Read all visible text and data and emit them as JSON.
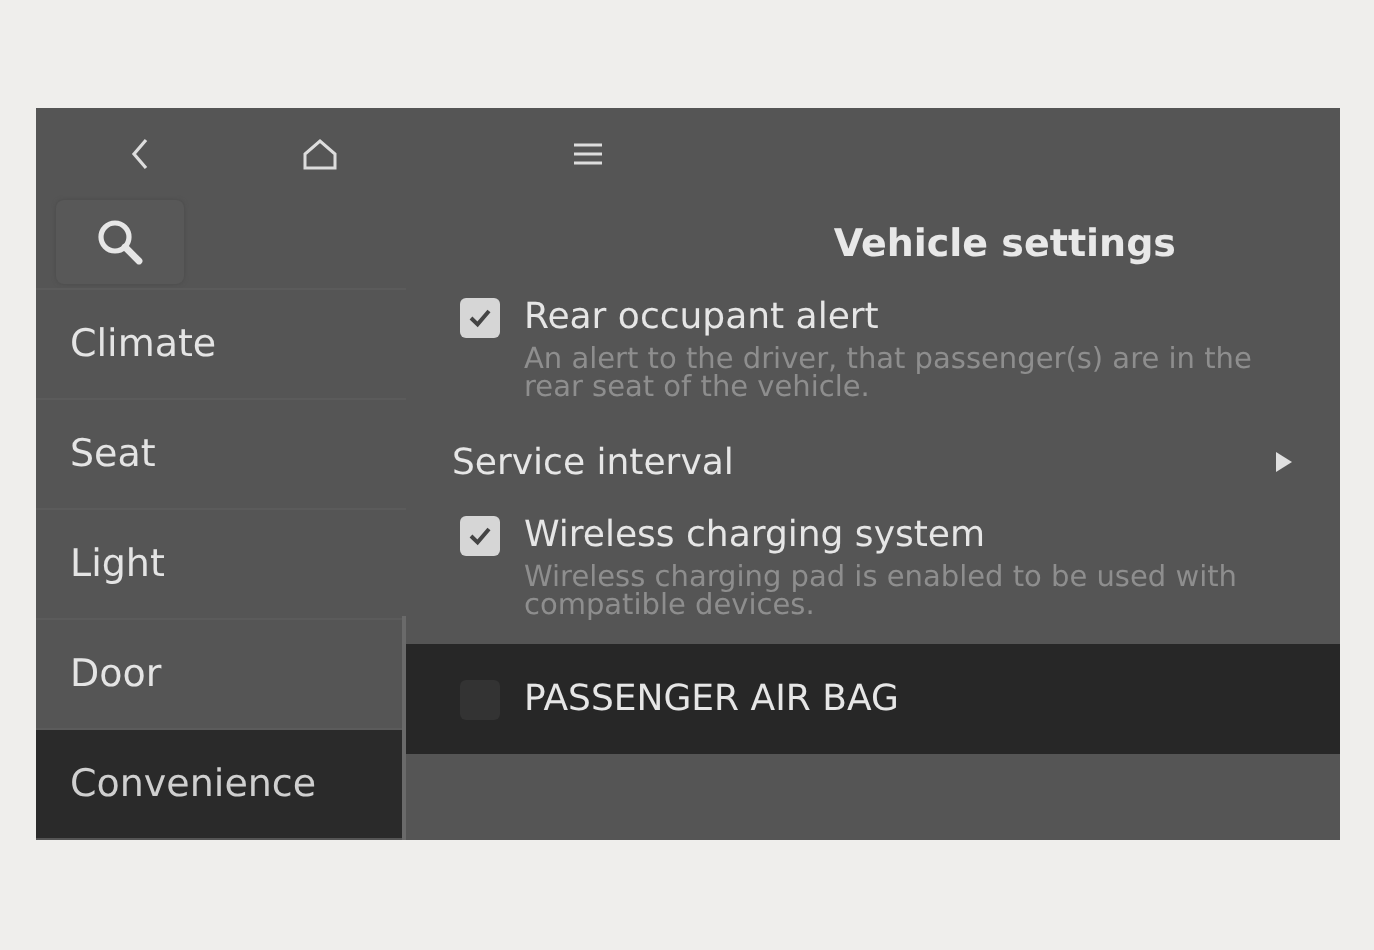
{
  "top_bar": {
    "buttons": [
      {
        "kind": "back"
      },
      {
        "kind": "home"
      },
      {
        "kind": "menu"
      }
    ]
  },
  "sidebar": {
    "items": [
      {
        "label": "Climate",
        "selected": false
      },
      {
        "label": "Seat",
        "selected": false
      },
      {
        "label": "Light",
        "selected": false
      },
      {
        "label": "Door",
        "selected": false
      },
      {
        "label": "Convenience",
        "selected": true
      }
    ]
  },
  "title": "Vehicle settings",
  "settings": [
    {
      "kind": "checkbox",
      "label": "Rear occupant alert",
      "description": "An alert to the driver, that passenger(s) are in the rear seat of the vehicle.",
      "checked": true,
      "selected": false
    },
    {
      "kind": "link",
      "label": "Service interval",
      "selected": false
    },
    {
      "kind": "checkbox",
      "label": "Wireless charging system",
      "description": "Wireless charging pad is enabled to be used with compatible devices.",
      "checked": true,
      "selected": false
    },
    {
      "kind": "checkbox",
      "label": "PASSENGER AIR BAG",
      "checked": false,
      "selected": true
    }
  ]
}
